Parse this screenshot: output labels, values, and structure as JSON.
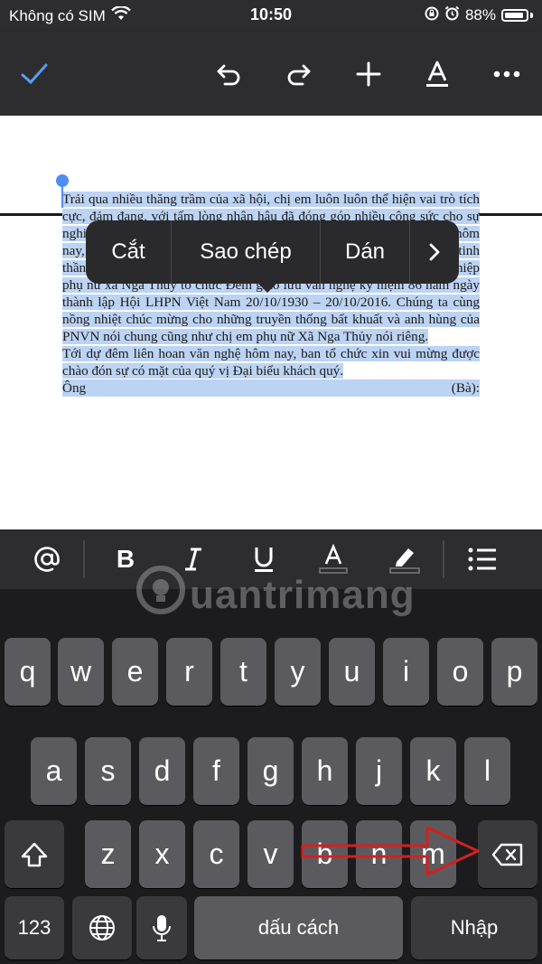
{
  "status": {
    "carrier": "Không có SIM",
    "time": "10:50",
    "battery": "88%"
  },
  "toolbar": {
    "icons": [
      "check-icon",
      "undo-icon",
      "redo-icon",
      "plus-icon",
      "text-format-icon",
      "more-icon"
    ]
  },
  "context_menu": {
    "cut": "Cắt",
    "copy": "Sao chép",
    "paste": "Dán",
    "more_icon": "chevron-right-icon"
  },
  "document": {
    "paragraphs": [
      "Trải qua nhiều thăng trầm của xã hội, chị em luôn luôn thể hiện vai trò tích cực, đảm đang, với tấm lòng nhân hậu đã đóng góp nhiều công sức cho sự nghiệp giải phóng dân tộc, giành độc lập cho đất nước. Tính đến ngày hôm nay, 20/10/2016, Hội liên hiệp phụ nữ Việt Nam đã 86 năm tuổi. Trên tinh thần đó được sự nhất trí của Đảng ủy,UBND xã Nga Thủy, hội liên hiệp phụ nữ xã Nga Thủy tổ chức Đêm giao lưu văn nghệ kỷ niệm 86 năm ngày thành lập Hội LHPN Việt Nam 20/10/1930 – 20/10/2016. Chúng ta cùng nồng nhiệt chúc mừng cho những truyền thống bất khuất và anh hùng của PNVN nói chung cũng như chị em phụ nữ Xã Nga Thủy nói riêng.",
      "Tới dự đêm liên hoan văn nghệ hôm nay, ban tổ chức xin vui mừng được chào đón sự có mặt của quý vị Đại biểu khách quý."
    ],
    "last_left": "Ông",
    "last_right": "(Bà):"
  },
  "format_bar": {
    "icons": [
      "at-icon",
      "bold-icon",
      "italic-icon",
      "underline-icon",
      "text-color-icon",
      "highlight-icon",
      "list-icon"
    ]
  },
  "keyboard": {
    "row1": [
      "q",
      "w",
      "e",
      "r",
      "t",
      "y",
      "u",
      "i",
      "o",
      "p"
    ],
    "row2": [
      "a",
      "s",
      "d",
      "f",
      "g",
      "h",
      "j",
      "k",
      "l"
    ],
    "row3": [
      "z",
      "x",
      "c",
      "v",
      "b",
      "n",
      "m"
    ],
    "numbers": "123",
    "space": "dấu cách",
    "return": "Nhập"
  },
  "watermark": "uantrimang",
  "colors": {
    "selection": "#bcd3f3",
    "accent": "#4d8ef0",
    "arrow": "#d42020"
  }
}
